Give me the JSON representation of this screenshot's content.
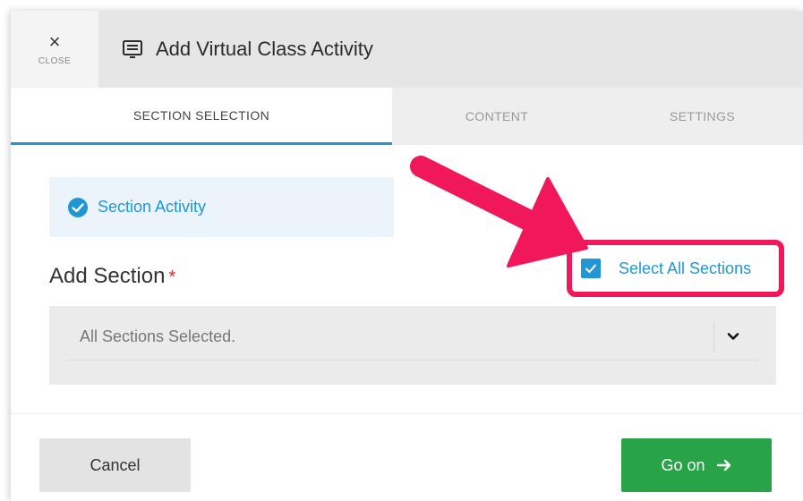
{
  "header": {
    "close_icon": "close-icon",
    "close_label": "CLOSE",
    "title_icon": "screen-message-icon",
    "title": "Add Virtual Class Activity"
  },
  "tabs": [
    {
      "label": "SECTION SELECTION",
      "active": true
    },
    {
      "label": "CONTENT",
      "active": false
    },
    {
      "label": "SETTINGS",
      "active": false
    }
  ],
  "section_activity": {
    "icon": "check-circle-icon",
    "label": "Section Activity"
  },
  "add_section": {
    "label": "Add Section",
    "required_mark": "*"
  },
  "select_all": {
    "checked": true,
    "label": "Select All Sections"
  },
  "dropdown": {
    "value": "All Sections Selected.",
    "icon": "chevron-down-icon"
  },
  "footer": {
    "cancel_label": "Cancel",
    "go_on_label": "Go on",
    "go_on_icon": "arrow-right-icon"
  },
  "colors": {
    "accent_blue": "#2196d6",
    "highlight_pink": "#f0185a",
    "go_green": "#29a347",
    "required_red": "#d9232e"
  }
}
